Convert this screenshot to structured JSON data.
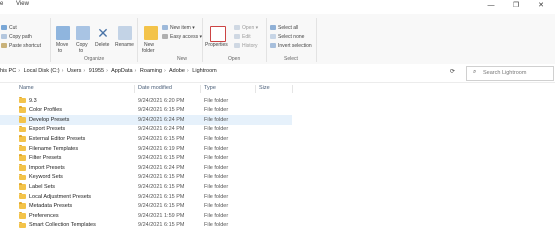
{
  "window": {
    "tabs": [
      "e",
      "View"
    ],
    "controls": {
      "minimize": "—",
      "maximize": "❐",
      "close": "✕"
    }
  },
  "ribbon": {
    "clipboard": {
      "cut": "Cut",
      "copy_path": "Copy path",
      "paste_shortcut": "Paste shortcut"
    },
    "organize": {
      "move_to": [
        "Move",
        "to"
      ],
      "copy_to": [
        "Copy",
        "to"
      ],
      "delete": "Delete",
      "rename": "Rename",
      "group_label": "Organize"
    },
    "new": {
      "new_folder": [
        "New",
        "folder"
      ],
      "new_item": "New item",
      "easy_access": "Easy access",
      "group_label": "New"
    },
    "open": {
      "properties": "Properties",
      "open": "Open",
      "edit": "Edit",
      "history": "History",
      "group_label": "Open"
    },
    "select": {
      "select_all": "Select all",
      "select_none": "Select none",
      "invert_selection": "Invert selection",
      "group_label": "Select"
    }
  },
  "address": {
    "crumbs": [
      "his PC",
      "Local Disk (C:)",
      "Users",
      "91955",
      "AppData",
      "Roaming",
      "Adobe",
      "Lightroom"
    ],
    "search_placeholder": "Search Lightroom"
  },
  "columns": {
    "name": "Name",
    "date": "Date modified",
    "type": "Type",
    "size": "Size"
  },
  "files": [
    {
      "name": "9.3",
      "date": "9/24/2021 6:20 PM",
      "type": "File folder"
    },
    {
      "name": "Color Profiles",
      "date": "9/24/2021 6:15 PM",
      "type": "File folder"
    },
    {
      "name": "Develop Presets",
      "date": "9/24/2021 6:24 PM",
      "type": "File folder",
      "selected": true
    },
    {
      "name": "Export Presets",
      "date": "9/24/2021 6:24 PM",
      "type": "File folder"
    },
    {
      "name": "External Editor Presets",
      "date": "9/24/2021 6:15 PM",
      "type": "File folder"
    },
    {
      "name": "Filename Templates",
      "date": "9/24/2021 6:19 PM",
      "type": "File folder"
    },
    {
      "name": "Filter Presets",
      "date": "9/24/2021 6:15 PM",
      "type": "File folder"
    },
    {
      "name": "Import Presets",
      "date": "9/24/2021 6:24 PM",
      "type": "File folder"
    },
    {
      "name": "Keyword Sets",
      "date": "9/24/2021 6:15 PM",
      "type": "File folder"
    },
    {
      "name": "Label Sets",
      "date": "9/24/2021 6:15 PM",
      "type": "File folder"
    },
    {
      "name": "Local Adjustment Presets",
      "date": "9/24/2021 6:15 PM",
      "type": "File folder"
    },
    {
      "name": "Metadata Presets",
      "date": "9/24/2021 6:15 PM",
      "type": "File folder"
    },
    {
      "name": "Preferences",
      "date": "9/24/2021 1:59 PM",
      "type": "File folder"
    },
    {
      "name": "Smart Collection Templates",
      "date": "9/24/2021 6:15 PM",
      "type": "File folder"
    }
  ]
}
